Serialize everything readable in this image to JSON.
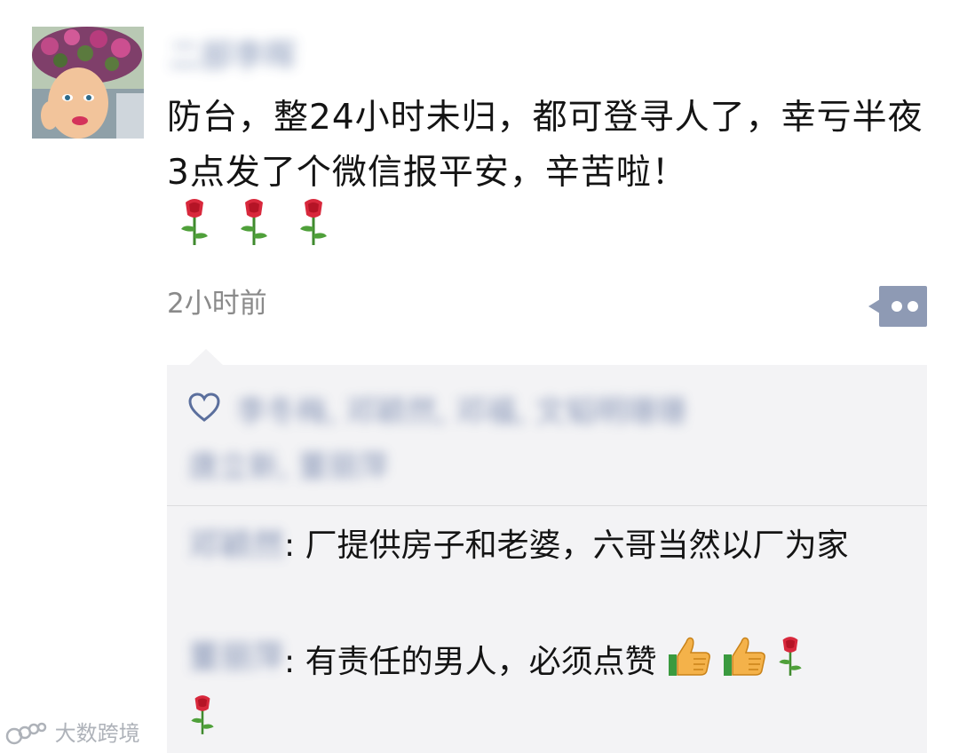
{
  "post": {
    "author": "二部李晖",
    "text": "防台，整24小时未归，都可登寻人了，幸亏半夜3点发了个微信报平安，辛苦啦！",
    "roses": [
      "rose-emoji",
      "rose-emoji",
      "rose-emoji"
    ],
    "time": "2小时前",
    "more_icon": "more-dots-icon"
  },
  "likes": {
    "icon": "heart-icon",
    "names_line1": "李冬梅, 邓颖然, 邓福, 文韬明珊珊",
    "names_line2": "唐立新, 董丽萍"
  },
  "comments": [
    {
      "author": "邓颖然",
      "separator": ": ",
      "text": "厂提供房子和老婆，六哥当然以厂为家"
    },
    {
      "author": "董丽萍",
      "separator": ": ",
      "text": "有责任的男人，必须点赞",
      "emojis": [
        "thumbs-up-emoji",
        "thumbs-up-emoji",
        "rose-emoji",
        "rose-emoji"
      ]
    }
  ],
  "watermark": {
    "text": "大数跨境"
  },
  "colors": {
    "link_blue": "#5b6f9d",
    "time_gray": "#8a8a8a",
    "panel_bg": "#f3f3f5",
    "more_button": "#8e9ab4"
  }
}
